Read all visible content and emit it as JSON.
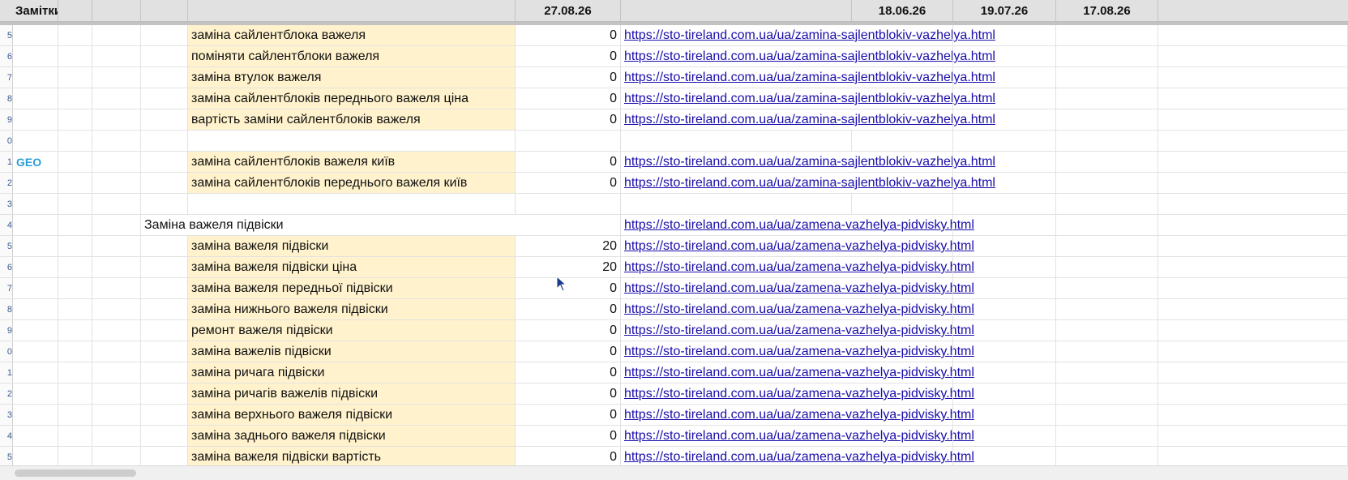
{
  "header": {
    "notes_label": "Замітки",
    "dates": [
      "27.08.26",
      "18.06.26",
      "19.07.26",
      "17.08.26"
    ]
  },
  "group_label": "GEO",
  "rows": [
    {
      "num": "5",
      "keyword": "заміна сайлентблока важеля",
      "value": "0",
      "url": "https://sto-tireland.com.ua/ua/zamina-sajlentblokiv-vazhelya.html"
    },
    {
      "num": "6",
      "keyword": "поміняти сайлентблоки важеля",
      "value": "0",
      "url": "https://sto-tireland.com.ua/ua/zamina-sajlentblokiv-vazhelya.html"
    },
    {
      "num": "7",
      "keyword": "заміна втулок важеля",
      "value": "0",
      "url": "https://sto-tireland.com.ua/ua/zamina-sajlentblokiv-vazhelya.html"
    },
    {
      "num": "8",
      "keyword": "заміна сайлентблоків переднього важеля ціна",
      "value": "0",
      "url": "https://sto-tireland.com.ua/ua/zamina-sajlentblokiv-vazhelya.html"
    },
    {
      "num": "9",
      "keyword": "вартість заміни сайлентблоків важеля",
      "value": "0",
      "url": "https://sto-tireland.com.ua/ua/zamina-sajlentblokiv-vazhelya.html"
    },
    {
      "num": "0",
      "empty": true
    },
    {
      "num": "1",
      "geo": true,
      "keyword": "заміна сайлентблоків важеля київ",
      "value": "0",
      "url": "https://sto-tireland.com.ua/ua/zamina-sajlentblokiv-vazhelya.html"
    },
    {
      "num": "2",
      "keyword": "заміна сайлентблоків переднього важеля київ",
      "value": "0",
      "url": "https://sto-tireland.com.ua/ua/zamina-sajlentblokiv-vazhelya.html"
    },
    {
      "num": "3",
      "empty": true
    },
    {
      "num": "4",
      "group": "Заміна важеля підвіски",
      "url": "https://sto-tireland.com.ua/ua/zamena-vazhelya-pidvisky.html"
    },
    {
      "num": "5",
      "keyword": "заміна важеля підвіски",
      "value": "20",
      "url": "https://sto-tireland.com.ua/ua/zamena-vazhelya-pidvisky.html"
    },
    {
      "num": "6",
      "keyword": "заміна важеля підвіски ціна",
      "value": "20",
      "url": "https://sto-tireland.com.ua/ua/zamena-vazhelya-pidvisky.html"
    },
    {
      "num": "7",
      "keyword": "заміна важеля передньої підвіски",
      "value": "0",
      "url": "https://sto-tireland.com.ua/ua/zamena-vazhelya-pidvisky.html"
    },
    {
      "num": "8",
      "keyword": "заміна нижнього важеля підвіски",
      "value": "0",
      "url": "https://sto-tireland.com.ua/ua/zamena-vazhelya-pidvisky.html"
    },
    {
      "num": "9",
      "keyword": "ремонт важеля підвіски",
      "value": "0",
      "url": "https://sto-tireland.com.ua/ua/zamena-vazhelya-pidvisky.html"
    },
    {
      "num": "0",
      "keyword": "заміна важелів підвіски",
      "value": "0",
      "url": "https://sto-tireland.com.ua/ua/zamena-vazhelya-pidvisky.html"
    },
    {
      "num": "1",
      "keyword": "заміна ричага підвіски",
      "value": "0",
      "url": "https://sto-tireland.com.ua/ua/zamena-vazhelya-pidvisky.html"
    },
    {
      "num": "2",
      "keyword": "заміна ричагів важелів підвіски",
      "value": "0",
      "url": "https://sto-tireland.com.ua/ua/zamena-vazhelya-pidvisky.html"
    },
    {
      "num": "3",
      "keyword": "заміна верхнього важеля підвіски",
      "value": "0",
      "url": "https://sto-tireland.com.ua/ua/zamena-vazhelya-pidvisky.html"
    },
    {
      "num": "4",
      "keyword": "заміна заднього важеля підвіски",
      "value": "0",
      "url": "https://sto-tireland.com.ua/ua/zamena-vazhelya-pidvisky.html"
    },
    {
      "num": "5",
      "keyword": "заміна важеля підвіски вартість",
      "value": "0",
      "url": "https://sto-tireland.com.ua/ua/zamena-vazhelya-pidvisky.html"
    }
  ]
}
